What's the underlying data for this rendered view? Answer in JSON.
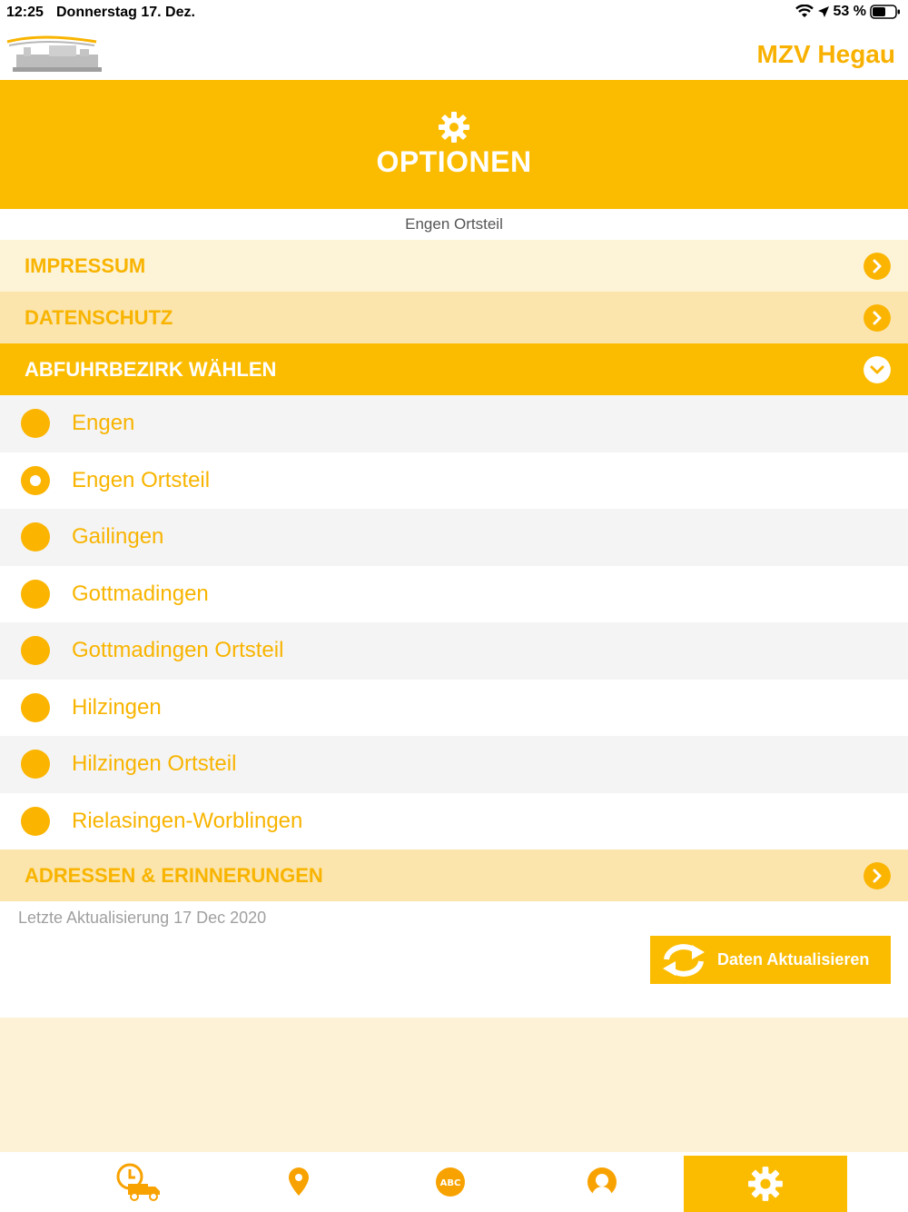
{
  "statusbar": {
    "time": "12:25",
    "date": "Donnerstag 17. Dez.",
    "battery": "53 %"
  },
  "topbar": {
    "brand": "MZV Hegau"
  },
  "header": {
    "title": "OPTIONEN",
    "icon": "gear-icon"
  },
  "subtitle": "Engen Ortsteil",
  "menu": {
    "impressum": "IMPRESSUM",
    "datenschutz": "DATENSCHUTZ",
    "abfuhrbezirk": "ABFUHRBEZIRK WÄHLEN",
    "adressen": "ADRESSEN & ERINNERUNGEN"
  },
  "districts": [
    {
      "label": "Engen",
      "selected": false
    },
    {
      "label": "Engen Ortsteil",
      "selected": true
    },
    {
      "label": "Gailingen",
      "selected": false
    },
    {
      "label": "Gottmadingen",
      "selected": false
    },
    {
      "label": "Gottmadingen Ortsteil",
      "selected": false
    },
    {
      "label": "Hilzingen",
      "selected": false
    },
    {
      "label": "Hilzingen Ortsteil",
      "selected": false
    },
    {
      "label": "Rielasingen-Worblingen",
      "selected": false
    }
  ],
  "last_update": "Letzte Aktualisierung 17 Dec 2020",
  "refresh_button": "Daten Aktualisieren",
  "tabs": [
    {
      "icon": "truck-clock-icon",
      "active": false
    },
    {
      "icon": "location-pin-icon",
      "active": false
    },
    {
      "icon": "abc-icon",
      "active": false
    },
    {
      "icon": "user-icon",
      "active": false
    },
    {
      "icon": "gear-icon",
      "active": true
    }
  ],
  "colors": {
    "accent": "#fbbc00",
    "text_accent": "#f8b400",
    "light_row": "#fdf3d7",
    "medium_row": "#fbe5ac",
    "footer_bg": "#fdf1d6"
  }
}
